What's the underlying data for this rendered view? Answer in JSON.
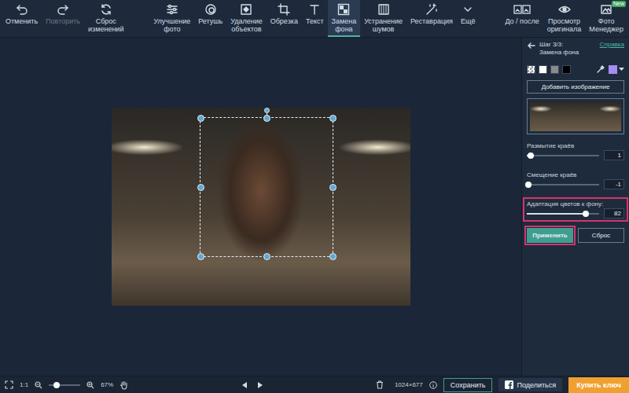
{
  "toolbar": {
    "history": [
      {
        "label": "Отменить",
        "disabled": false
      },
      {
        "label": "Повторить",
        "disabled": true
      },
      {
        "label": "Сброс\nизменений",
        "disabled": false
      }
    ],
    "tools": [
      {
        "label": "Улучшение\nфото",
        "selected": false
      },
      {
        "label": "Ретушь",
        "selected": false
      },
      {
        "label": "Удаление\nобъектов",
        "selected": false
      },
      {
        "label": "Обрезка",
        "selected": false
      },
      {
        "label": "Текст",
        "selected": false
      },
      {
        "label": "Замена\nфона",
        "selected": true
      },
      {
        "label": "Устранение\nшумов",
        "selected": false
      },
      {
        "label": "Реставрация",
        "selected": false
      },
      {
        "label": "Ещё",
        "selected": false
      }
    ],
    "views": [
      {
        "label": "До / после",
        "badge": ""
      },
      {
        "label": "Просмотр\nоригинала",
        "badge": ""
      },
      {
        "label": "Фото\nМенеджер",
        "badge": "New"
      }
    ]
  },
  "panel": {
    "step": "Шаг 3/3:\nЗамена фона",
    "help": "Справка",
    "swatches": [
      {
        "kind": "transparent",
        "selected": false
      },
      {
        "kind": "solid",
        "color": "#ffffff",
        "selected": false
      },
      {
        "kind": "solid",
        "color": "#8a8a8a",
        "selected": false
      },
      {
        "kind": "solid",
        "color": "#000000",
        "selected": false
      }
    ],
    "picked_color": "#a58cf0",
    "add_image": "Добавить изображение",
    "sliders": [
      {
        "label": "Размытие краёв",
        "value": "1",
        "level": 0.05,
        "highlighted": false
      },
      {
        "label": "Смещение краёв",
        "value": "-1",
        "level": 0.02,
        "highlighted": false
      },
      {
        "label": "Адаптация цветов к фону:",
        "value": "82",
        "level": 0.82,
        "highlighted": true
      }
    ],
    "buttons": [
      {
        "label": "Применить",
        "primary": true,
        "highlighted": true
      },
      {
        "label": "Сброс",
        "primary": false,
        "highlighted": false
      }
    ]
  },
  "status_bar": {
    "ratio": "1:1",
    "zoom_level": 0.25,
    "zoom": "67%",
    "size": "1024×677",
    "buttons": [
      {
        "label": "Сохранить",
        "kind": "save"
      },
      {
        "label": "Поделиться",
        "kind": "share"
      },
      {
        "label": "Купить ключ",
        "kind": "buy"
      }
    ]
  }
}
